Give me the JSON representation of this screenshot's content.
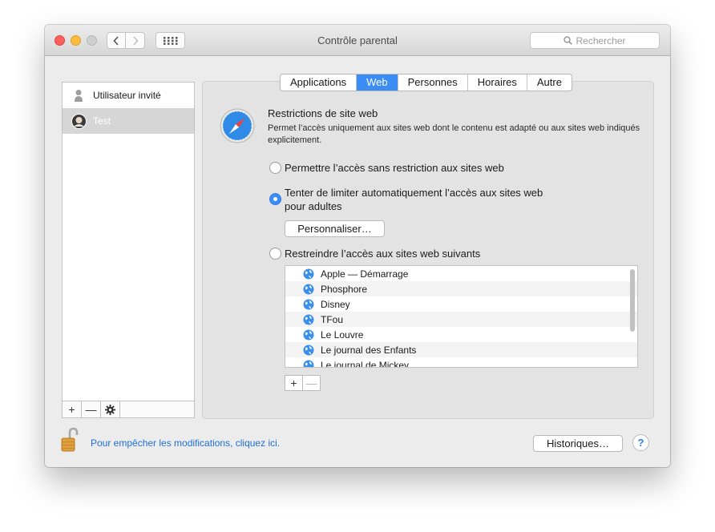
{
  "window": {
    "title": "Contrôle parental"
  },
  "toolbar": {
    "search_placeholder": "Rechercher"
  },
  "users": [
    {
      "name": "Utilisateur invité",
      "selected": false
    },
    {
      "name": "Test",
      "selected": true
    }
  ],
  "user_actions": {
    "add": "+",
    "remove": "—"
  },
  "tabs": [
    {
      "label": "Applications",
      "active": false
    },
    {
      "label": "Web",
      "active": true
    },
    {
      "label": "Personnes",
      "active": false
    },
    {
      "label": "Horaires",
      "active": false
    },
    {
      "label": "Autre",
      "active": false
    }
  ],
  "web": {
    "heading": "Restrictions de site web",
    "description": "Permet l’accès uniquement aux sites web dont le contenu est adapté ou aux sites web indiqués explicitement.",
    "option_unrestricted": "Permettre l’accès sans restriction aux sites web",
    "option_limit_adult": "Tenter de limiter automatiquement l’accès aux sites web pour adultes",
    "option_restrict_list": "Restreindre l’accès aux sites web suivants",
    "selected_option": "limit_adult",
    "customize_button": "Personnaliser…",
    "sites": [
      "Apple — Démarrage",
      "Phosphore",
      "Disney",
      "TFou",
      "Le Louvre",
      "Le journal des Enfants",
      "Le journal de Mickey"
    ],
    "add": "+",
    "remove": "—"
  },
  "footer": {
    "lock_text": "Pour empêcher les modifications, cliquez ici.",
    "history_button": "Historiques…",
    "help": "?"
  },
  "colors": {
    "accent": "#3b8cf5",
    "link": "#1e6fd2",
    "close": "#fc605b",
    "minimize": "#fdbc40"
  }
}
